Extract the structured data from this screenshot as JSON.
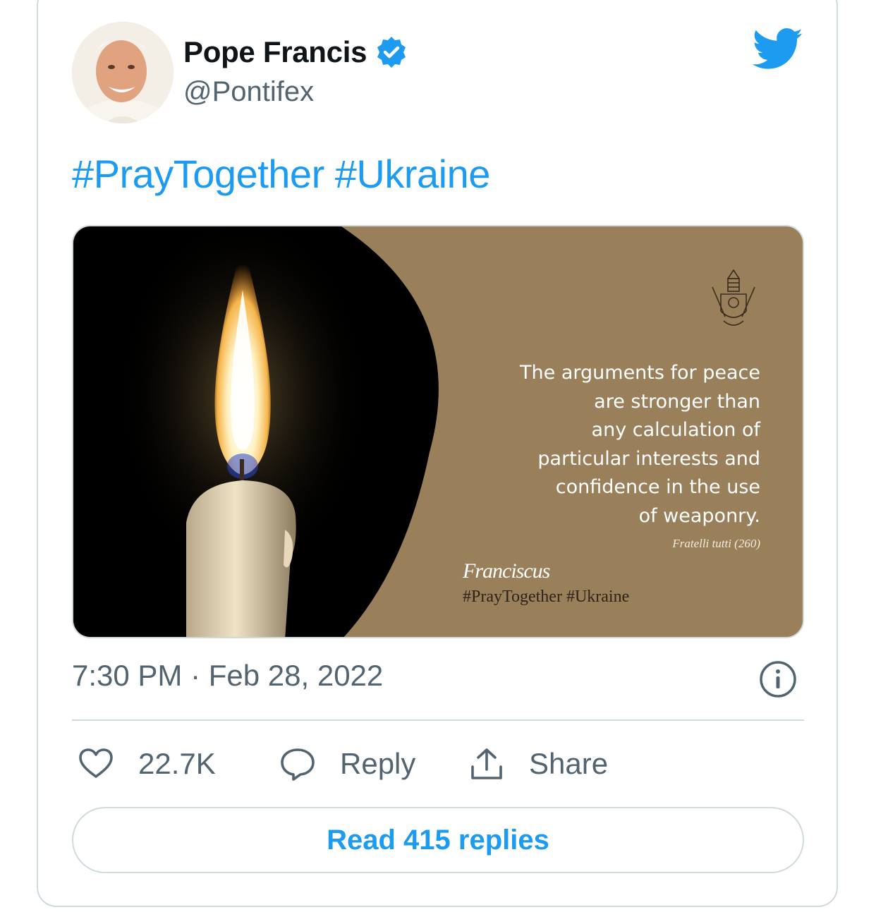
{
  "tweet": {
    "author_name": "Pope Francis",
    "handle": "@Pontifex",
    "hashtags": [
      "#PrayTogether",
      "#Ukraine"
    ],
    "timestamp": "7:30 PM · Feb 28, 2022"
  },
  "media": {
    "quote_lines": [
      "The arguments for peace",
      "are stronger than",
      "any calculation of",
      "particular interests and",
      "confidence in the use",
      "of weaponry."
    ],
    "source": "Fratelli tutti (260)",
    "signature": "Franciscus",
    "hashtags": "#PrayTogether #Ukraine"
  },
  "actions": {
    "likes": "22.7K",
    "reply_label": "Reply",
    "share_label": "Share"
  },
  "read_replies_label": "Read 415 replies",
  "colors": {
    "link_blue": "#1d9bf0",
    "muted_gray": "#536471",
    "border_gray": "#cfd9de",
    "image_tan": "#9a7f5b"
  },
  "icons": [
    "avatar",
    "verified-badge-icon",
    "twitter-bird-icon",
    "info-icon",
    "heart-icon",
    "reply-bubble-icon",
    "share-icon",
    "papal-crest-icon",
    "candle-image"
  ]
}
